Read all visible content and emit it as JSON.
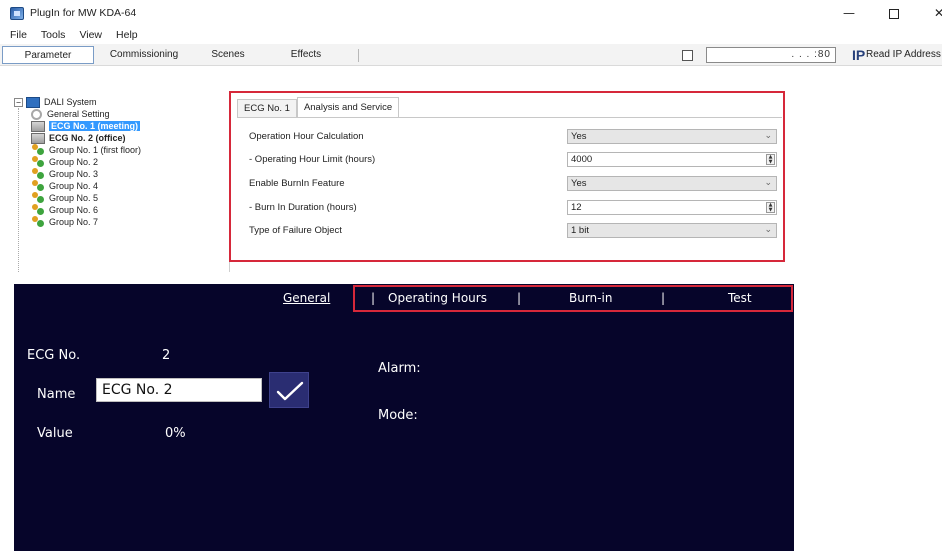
{
  "window": {
    "title": "PlugIn for MW KDA-64",
    "controls": {
      "minimize": "—",
      "close": "✕"
    }
  },
  "menu": [
    "File",
    "Tools",
    "View",
    "Help"
  ],
  "toolbar": {
    "tabs": [
      "Parameter",
      "Commissioning",
      "Scenes",
      "Effects"
    ],
    "active_tab": "Parameter",
    "ip_value": ". . . :80",
    "read_ip_label": "Read IP Address"
  },
  "tree": {
    "root": "DALI System",
    "items": [
      "General Setting",
      "ECG No. 1 (meeting)",
      "ECG No. 2 (office)",
      "Group No. 1 (first floor)",
      "Group No. 2",
      "Group No. 3",
      "Group No. 4",
      "Group No. 5",
      "Group No. 6",
      "Group No. 7"
    ],
    "selected": "ECG No. 1 (meeting)"
  },
  "panel": {
    "tabs": [
      "ECG No. 1",
      "Analysis and Service"
    ],
    "active_tab": "Analysis and Service",
    "rows": [
      {
        "label": "Operation Hour Calculation",
        "value": "Yes",
        "control": "select"
      },
      {
        "label": "- Operating Hour Limit (hours)",
        "value": "4000",
        "control": "number"
      },
      {
        "label": "Enable BurnIn Feature",
        "value": "Yes",
        "control": "select"
      },
      {
        "label": "- Burn In Duration (hours)",
        "value": "12",
        "control": "number"
      },
      {
        "label": "Type of Failure Object",
        "value": "1 bit",
        "control": "select"
      }
    ]
  },
  "visu": {
    "nav": {
      "general": "General",
      "sep": "|",
      "operating_hours": "Operating Hours",
      "burn_in": "Burn-in",
      "test": "Test"
    },
    "ecg_label": "ECG No.",
    "ecg_value": "2",
    "name_label": "Name",
    "name_value": "ECG No. 2",
    "value_label": "Value",
    "value_value": "0%",
    "alarm_label": "Alarm:",
    "mode_label": "Mode:"
  },
  "colors": {
    "highlight": "#d6283a",
    "visu_background": "#06052a",
    "selection": "#3399ff"
  }
}
